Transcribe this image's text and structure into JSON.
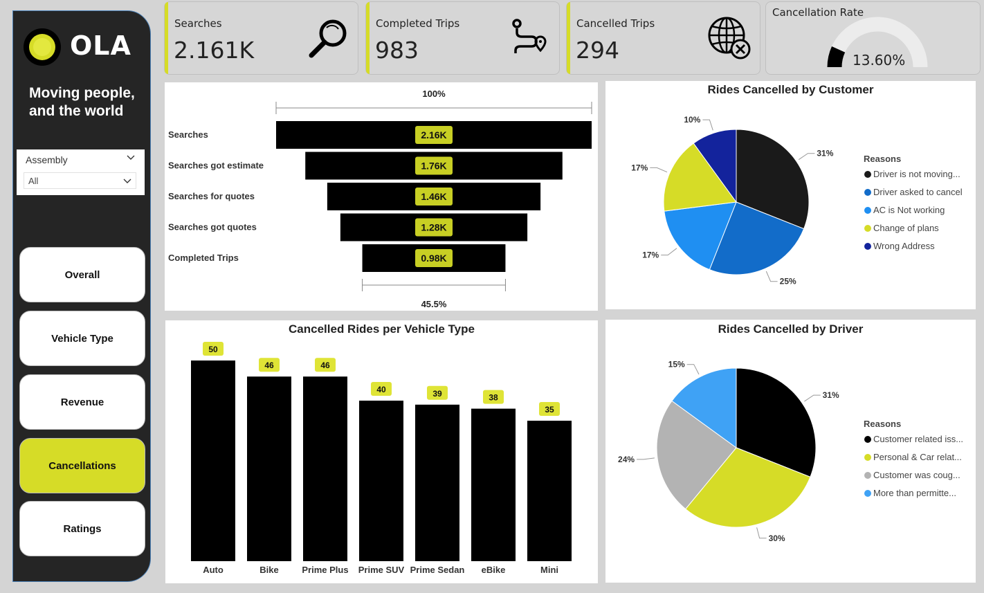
{
  "brand": {
    "logo_text": "OLA",
    "tagline_line1": "Moving people,",
    "tagline_line2": "and the world",
    "accent_color": "#d6dc27"
  },
  "slicer": {
    "label": "Assembly",
    "value": "All"
  },
  "nav": [
    {
      "label": "Overall",
      "active": false
    },
    {
      "label": "Vehicle Type",
      "active": false
    },
    {
      "label": "Revenue",
      "active": false
    },
    {
      "label": "Cancellations",
      "active": true
    },
    {
      "label": "Ratings",
      "active": false
    }
  ],
  "kpis": {
    "searches": {
      "title": "Searches",
      "value": "2.161K",
      "icon": "search-icon"
    },
    "completed": {
      "title": "Completed Trips",
      "value": "983",
      "icon": "route-icon"
    },
    "cancelled": {
      "title": "Cancelled Trips",
      "value": "294",
      "icon": "globe-cancel-icon"
    },
    "rate": {
      "title": "Cancellation Rate",
      "value": "13.60%",
      "fraction": 0.136
    }
  },
  "chart_data": [
    {
      "type": "funnel",
      "top_label": "100%",
      "bottom_label": "45.5%",
      "stages": [
        {
          "label": "Searches",
          "value": 2.16,
          "display": "2.16K"
        },
        {
          "label": "Searches got estimate",
          "value": 1.76,
          "display": "1.76K"
        },
        {
          "label": "Searches for quotes",
          "value": 1.46,
          "display": "1.46K"
        },
        {
          "label": "Searches got quotes",
          "value": 1.28,
          "display": "1.28K"
        },
        {
          "label": "Completed Trips",
          "value": 0.98,
          "display": "0.98K"
        }
      ]
    },
    {
      "type": "pie",
      "title": "Rides Cancelled by Customer",
      "legend_title": "Reasons",
      "slices": [
        {
          "label": "Driver is not moving...",
          "value": 31,
          "display": "31%",
          "color": "#1a1a1a"
        },
        {
          "label": "Driver asked to cancel",
          "value": 25,
          "display": "25%",
          "color": "#126cc9"
        },
        {
          "label": "AC is Not working",
          "value": 17,
          "display": "17%",
          "color": "#1f8ff2"
        },
        {
          "label": "Change of plans",
          "value": 17,
          "display": "17%",
          "color": "#d6dc27"
        },
        {
          "label": "Wrong Address",
          "value": 10,
          "display": "10%",
          "color": "#13239c"
        }
      ]
    },
    {
      "type": "bar",
      "title": "Cancelled Rides per Vehicle Type",
      "categories": [
        "Auto",
        "Bike",
        "Prime Plus",
        "Prime SUV",
        "Prime Sedan",
        "eBike",
        "Mini"
      ],
      "values": [
        50,
        46,
        46,
        40,
        39,
        38,
        35
      ],
      "ylim": [
        0,
        50
      ]
    },
    {
      "type": "pie",
      "title": "Rides Cancelled by Driver",
      "legend_title": "Reasons",
      "slices": [
        {
          "label": "Customer related iss...",
          "value": 31,
          "display": "31%",
          "color": "#000000"
        },
        {
          "label": "Personal & Car relat...",
          "value": 30,
          "display": "30%",
          "color": "#d6dc27"
        },
        {
          "label": "Customer was coug...",
          "value": 24,
          "display": "24%",
          "color": "#b3b3b3"
        },
        {
          "label": "More than permitte...",
          "value": 15,
          "display": "15%",
          "color": "#3fa2f5"
        }
      ]
    }
  ]
}
